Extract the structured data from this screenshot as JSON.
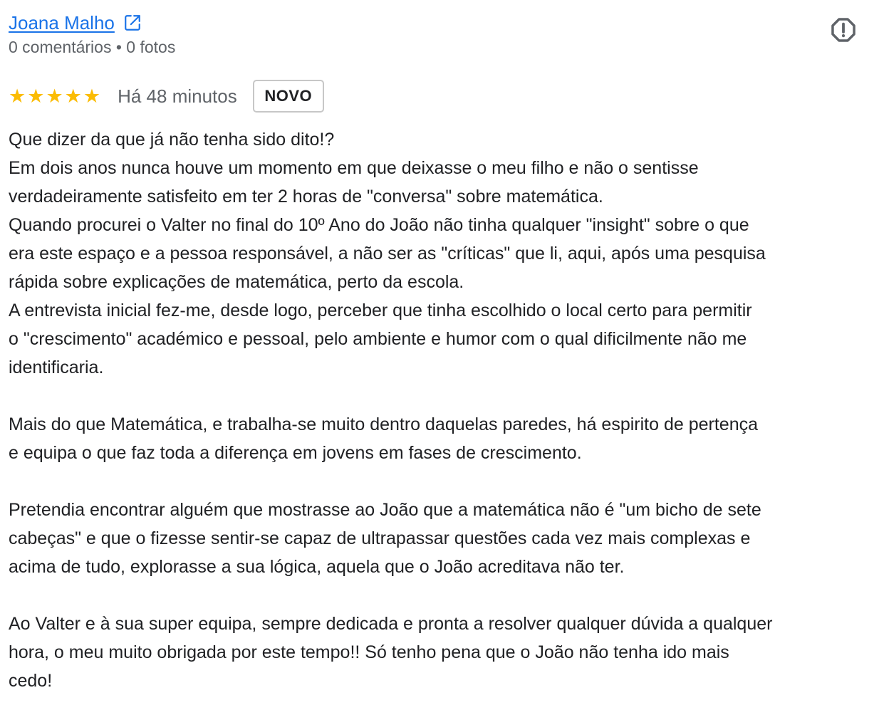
{
  "author": {
    "name": "Joana Malho",
    "meta": "0 comentários • 0 fotos"
  },
  "rating": {
    "stars": 5,
    "time": "Há 48 minutos",
    "badge": "NOVO"
  },
  "review": {
    "paragraphs": [
      {
        "lines": [
          "Que dizer da que já não tenha sido dito!?",
          "Em dois anos nunca houve um momento em que deixasse o meu filho e não o sentisse",
          "verdadeiramente satisfeito em ter 2 horas de \"conversa\" sobre matemática.",
          "Quando procurei o Valter no final do 10º Ano do João não tinha qualquer \"insight\" sobre o que",
          "era este espaço e a pessoa responsável, a não ser as \"críticas\" que li, aqui, após uma pesquisa",
          "rápida sobre explicações de matemática, perto da escola.",
          "A entrevista inicial fez-me, desde logo, perceber que tinha escolhido o local certo para permitir",
          "o \"crescimento\" académico e pessoal, pelo ambiente e humor com o qual dificilmente não me",
          "identificaria."
        ]
      },
      {
        "lines": [
          "Mais do que Matemática, e trabalha-se muito dentro daquelas paredes, há espirito de pertença",
          "e equipa o que faz toda a diferença em jovens em fases de crescimento."
        ]
      },
      {
        "lines": [
          "Pretendia encontrar alguém que mostrasse ao João que a matemática não é \"um bicho de sete",
          "cabeças\" e que o fizesse sentir-se capaz de ultrapassar questões cada vez mais complexas e",
          "acima de tudo, explorasse a sua lógica, aquela que o João acreditava não ter."
        ]
      },
      {
        "lines": [
          "Ao Valter e à sua super equipa, sempre dedicada e pronta a resolver qualquer dúvida a qualquer",
          "hora, o meu muito obrigada por este tempo!! Só tenho pena que o João não tenha ido mais",
          "cedo!"
        ]
      }
    ]
  },
  "colors": {
    "link": "#1a73e8",
    "star": "#fbbc04",
    "muted": "#5f6368",
    "text": "#202124"
  },
  "icons": {
    "external": "external-link-icon",
    "report": "report-icon"
  }
}
